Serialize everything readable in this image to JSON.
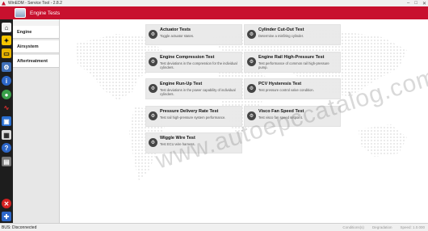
{
  "window": {
    "title": "WinEDM - Service Tool - 2.8.2",
    "controls": [
      "–",
      "□",
      "✕"
    ]
  },
  "header": {
    "title": "Engine Tests"
  },
  "toolbar": {
    "buttons": [
      {
        "icon": "home-icon"
      },
      {
        "icon": "network-icon"
      },
      {
        "icon": "folder-icon"
      },
      {
        "icon": "engine-icon"
      },
      {
        "icon": "info-icon"
      },
      {
        "icon": "diagnostic-icon"
      },
      {
        "icon": "waveform-icon"
      },
      {
        "icon": "monitor-icon"
      },
      {
        "icon": "calculator-icon"
      },
      {
        "icon": "help-icon"
      },
      {
        "icon": "save-icon"
      },
      {
        "icon": "close-icon"
      },
      {
        "icon": "puzzle-icon"
      }
    ]
  },
  "nav": {
    "items": [
      {
        "label": "Engine"
      },
      {
        "label": "Airsystem"
      },
      {
        "label": "Aftertreatment"
      }
    ]
  },
  "tests": [
    {
      "title": "Actuator Tests",
      "desc": "Toggle actuator states."
    },
    {
      "title": "Cylinder Cut-Out Test",
      "desc": "Determine a misfiring cylinder."
    },
    {
      "title": "Engine Compression Test",
      "desc": "Test deviations in the compression for the individual cylinders."
    },
    {
      "title": "Engine Rail High-Pressure Test",
      "desc": "Test performance of common rail high-pressure pump."
    },
    {
      "title": "Engine Run-Up Test",
      "desc": "Test deviations in the power capability of individual cylinders."
    },
    {
      "title": "PCV Hysteresis Test",
      "desc": "Test pressure control valve condition."
    },
    {
      "title": "Pressure Delivery Rate Test",
      "desc": "Test rail high-pressure system performance."
    },
    {
      "title": "Visco Fan Speed Test",
      "desc": "Test visco fan speed setpoint."
    },
    {
      "title": "Wiggle Wire Test",
      "desc": "Test ECU wire harness."
    }
  ],
  "watermark": "www.autoepccatalog.com",
  "status": {
    "connection": "BUS: Disconnected",
    "right": [
      "Conditions(s)",
      "Degradation",
      "Speed: 1.0.000"
    ]
  }
}
